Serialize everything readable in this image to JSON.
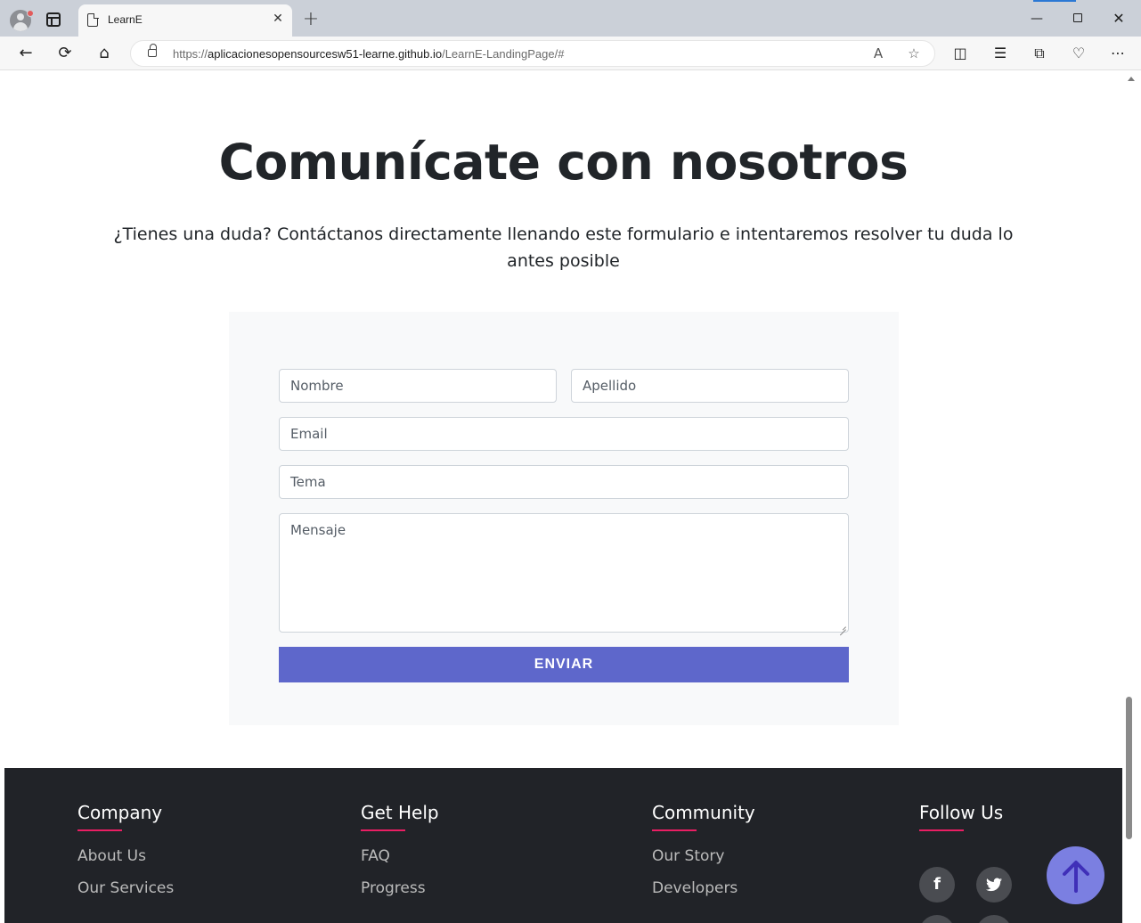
{
  "browser": {
    "tab_title": "LearnE",
    "tab_close": "✕",
    "new_tab": "+",
    "url_prefix": "https://",
    "url_host": "aplicacionesopensourcesw51-learne.github.io",
    "url_path": "/LearnE-LandingPage/#",
    "window_controls": {
      "minimize": "—",
      "close": "✕"
    }
  },
  "contact": {
    "title": "Comunícate con nosotros",
    "subtitle": "¿Tienes una duda? Contáctanos directamente llenando este formulario e intentaremos resolver tu duda lo antes posible",
    "form": {
      "nombre_placeholder": "Nombre",
      "apellido_placeholder": "Apellido",
      "email_placeholder": "Email",
      "tema_placeholder": "Tema",
      "mensaje_placeholder": "Mensaje",
      "submit_label": "ENVIAR"
    }
  },
  "footer": {
    "columns": [
      {
        "heading": "Company",
        "links": [
          "About Us",
          "Our Services"
        ]
      },
      {
        "heading": "Get Help",
        "links": [
          "FAQ",
          "Progress"
        ]
      },
      {
        "heading": "Community",
        "links": [
          "Our Story",
          "Developers"
        ]
      },
      {
        "heading": "Follow Us",
        "links": []
      }
    ],
    "social": [
      "facebook-icon",
      "twitter-icon",
      "instagram-icon",
      "youtube-icon"
    ],
    "accent_color": "#e91e63"
  },
  "colors": {
    "button": "#5e67cb",
    "footer_bg": "#212328",
    "back_to_top": "#7b7fe1"
  },
  "icons": {
    "back": "←",
    "reload": "⟳",
    "home": "⌂",
    "facebook": "f",
    "twitter": "t"
  }
}
